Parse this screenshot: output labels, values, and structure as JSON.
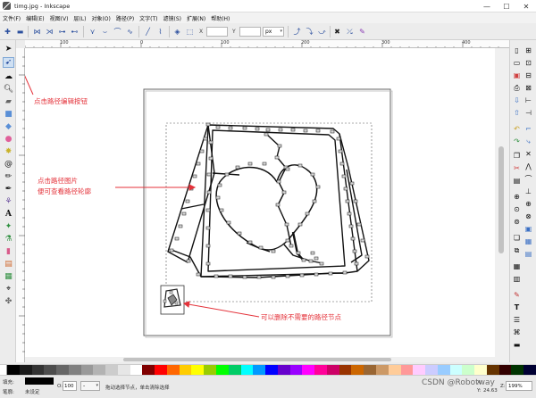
{
  "window": {
    "title": "timg.jpg - Inkscape",
    "controls": [
      "—",
      "☐",
      "✕"
    ]
  },
  "menu": [
    {
      "label": "文件(F)"
    },
    {
      "label": "编辑(E)"
    },
    {
      "label": "视图(V)"
    },
    {
      "label": "层(L)"
    },
    {
      "label": "对象(O)"
    },
    {
      "label": "路径(P)"
    },
    {
      "label": "文字(T)"
    },
    {
      "label": "滤镜(S)"
    },
    {
      "label": "扩展(N)"
    },
    {
      "label": "帮助(H)"
    }
  ],
  "toolcontrols": {
    "x_label": "X",
    "y_label": "Y",
    "x_value": "",
    "y_value": "",
    "unit": "px"
  },
  "ruler": {
    "h_marks": [
      "100",
      "0",
      "100",
      "200",
      "300",
      "400",
      "500",
      "600",
      "700"
    ]
  },
  "annotations": {
    "node_edit_button": "点击路径编辑按钮",
    "path_image_line1": "点击路径图片",
    "path_image_line2": "便可查看路径轮廓",
    "delete_nodes": "可以删除不需要的路径节点"
  },
  "status": {
    "fill_label": "填充:",
    "stroke_label": "笔廓:",
    "stroke_value": "未设定",
    "opacity_label": "O:",
    "opacity_value": "100",
    "layer_value": "-",
    "message": "拖动选择节点，单击清除选择",
    "x_label": "X:",
    "x_value": "",
    "y_label": "Y:",
    "y_value": "24.63",
    "zoom_label": "Z:",
    "zoom_value": "199%"
  },
  "watermark": "CSDN @Robotway",
  "colors": {
    "annotation_red": "#e4323a",
    "palette": [
      "#000000",
      "#1a1a1a",
      "#333333",
      "#4d4d4d",
      "#666666",
      "#808080",
      "#999999",
      "#b3b3b3",
      "#cccccc",
      "#e6e6e6",
      "#ffffff",
      "#800000",
      "#ff0000",
      "#ff6600",
      "#ffcc00",
      "#ffff00",
      "#99cc00",
      "#00ff00",
      "#00cc66",
      "#00ffff",
      "#0099ff",
      "#0000ff",
      "#6600cc",
      "#9900ff",
      "#ff00ff",
      "#ff0099",
      "#cc0066",
      "#993300",
      "#cc6600",
      "#996633",
      "#cc9966",
      "#ffcc99",
      "#ff9999",
      "#ffccff",
      "#ccccff",
      "#99ccff",
      "#ccffff",
      "#ccffcc",
      "#ffffcc",
      "#663300",
      "#330000",
      "#003300",
      "#000033"
    ]
  }
}
